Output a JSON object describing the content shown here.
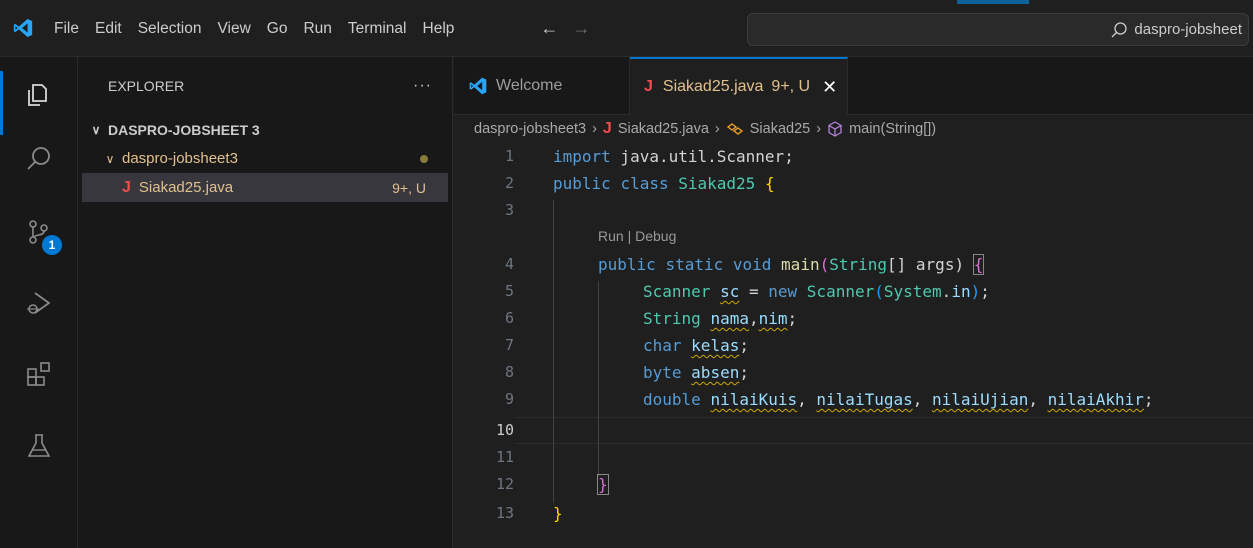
{
  "menu": [
    "File",
    "Edit",
    "Selection",
    "View",
    "Go",
    "Run",
    "Terminal",
    "Help"
  ],
  "command_center": {
    "text": "daspro-jobsheet"
  },
  "activity": {
    "scm_badge": "1"
  },
  "explorer": {
    "title": "EXPLORER",
    "more": "···",
    "root": "DASPRO-JOBSHEET 3",
    "folder": "daspro-jobsheet3",
    "file": {
      "icon": "J",
      "name": "Siakad25.java",
      "status": "9+, U"
    }
  },
  "tabs": [
    {
      "label": "Welcome"
    },
    {
      "icon": "J",
      "label": "Siakad25.java",
      "status": "9+, U",
      "close": "✕"
    }
  ],
  "breadcrumb": {
    "folder": "daspro-jobsheet3",
    "file_icon": "J",
    "file": "Siakad25.java",
    "class": "Siakad25",
    "method": "main(String[])"
  },
  "editor": {
    "codelens": "Run | Debug",
    "line_numbers": [
      "1",
      "2",
      "3",
      "4",
      "5",
      "6",
      "7",
      "8",
      "9",
      "10",
      "11",
      "12",
      "13"
    ],
    "current_line": "10",
    "tokens": {
      "l1_kw": "import",
      "l1_rest": " java.util.Scanner;",
      "l2_kw1": "public",
      "l2_kw2": "class",
      "l2_name": "Siakad25",
      "l2_brace": "{",
      "l4_kw1": "public",
      "l4_kw2": "static",
      "l4_kw3": "void",
      "l4_fn": "main",
      "l4_type": "String",
      "l4_rest": "[] args)",
      "l4_brace": "{",
      "l5_type": "Scanner",
      "l5_var": "sc",
      "l5_op": " = ",
      "l5_new": "new",
      "l5_type2": "Scanner",
      "l5_sys": "System",
      "l5_in": "in",
      "l6_type": "String",
      "l6_v1": "nama",
      "l6_v2": "nim",
      "l7_kw": "char",
      "l7_v": "kelas",
      "l8_kw": "byte",
      "l8_v": "absen",
      "l9_kw": "double",
      "l9_v1": "nilaiKuis",
      "l9_v2": "nilaiTugas",
      "l9_v3": "nilaiUjian",
      "l9_v4": "nilaiAkhir",
      "l12_brace": "}",
      "l13_brace": "}"
    }
  },
  "colors": {
    "accent": "#0078d4",
    "modified": "#e2c08d",
    "java": "#f14c4c"
  }
}
